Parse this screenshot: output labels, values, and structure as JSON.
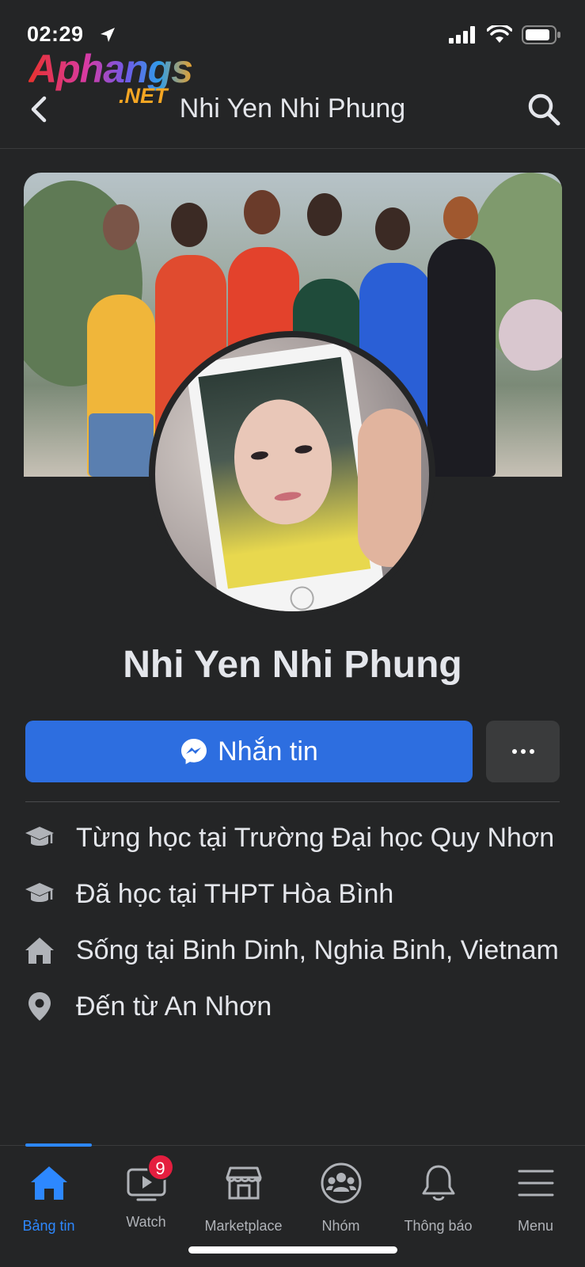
{
  "status_bar": {
    "time": "02:29"
  },
  "watermark": {
    "main": "Aphangs",
    "suffix": ".NET"
  },
  "header": {
    "title": "Nhi Yen Nhi Phung"
  },
  "profile": {
    "name": "Nhi Yen Nhi Phung"
  },
  "actions": {
    "message_label": "Nhắn tin"
  },
  "info": [
    {
      "icon": "graduation-cap-icon",
      "text": "Từng học tại Trường Đại học Quy Nhơn"
    },
    {
      "icon": "graduation-cap-icon",
      "text": "Đã học tại THPT Hòa Bình"
    },
    {
      "icon": "home-icon",
      "text": "Sống tại Binh Dinh, Nghia Binh, Vietnam"
    },
    {
      "icon": "location-pin-icon",
      "text": "Đến từ An Nhơn"
    }
  ],
  "tabs": [
    {
      "label": "Bảng tin",
      "icon": "home-icon",
      "active": true
    },
    {
      "label": "Watch",
      "icon": "video-icon",
      "badge": "9"
    },
    {
      "label": "Marketplace",
      "icon": "shop-icon"
    },
    {
      "label": "Nhóm",
      "icon": "groups-icon"
    },
    {
      "label": "Thông báo",
      "icon": "bell-icon"
    },
    {
      "label": "Menu",
      "icon": "menu-icon"
    }
  ],
  "colors": {
    "accent": "#2d88ff",
    "button": "#2d6ee0",
    "background": "#242526",
    "badge": "#e41e3f"
  }
}
